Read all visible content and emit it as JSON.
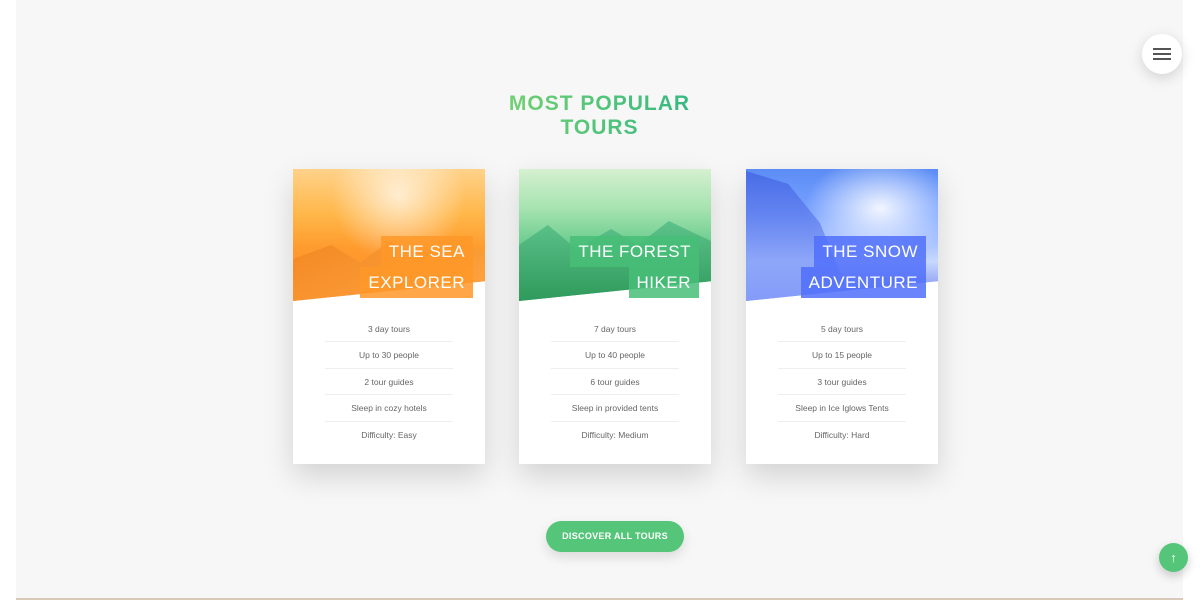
{
  "section": {
    "title": "MOST POPULAR TOURS"
  },
  "icons": {
    "menu": "hamburger-menu-icon",
    "scroll_top": "arrow-up-icon"
  },
  "colors": {
    "primary": "#55c57a",
    "orange": "#ff9b2e",
    "green": "#28b485",
    "blue": "#5b73f5"
  },
  "tours": [
    {
      "heading_line1": "THE SEA",
      "heading_line2": "EXPLORER",
      "details": [
        "3 day tours",
        "Up to 30 people",
        "2 tour guides",
        "Sleep in cozy hotels",
        "Difficulty: Easy"
      ]
    },
    {
      "heading_line1": "THE FOREST",
      "heading_line2": "HIKER",
      "details": [
        "7 day tours",
        "Up to 40 people",
        "6 tour guides",
        "Sleep in provided tents",
        "Difficulty: Medium"
      ]
    },
    {
      "heading_line1": "THE SNOW",
      "heading_line2": "ADVENTURE",
      "details": [
        "5 day tours",
        "Up to 15 people",
        "3 tour guides",
        "Sleep in Ice Iglows Tents",
        "Difficulty: Hard"
      ]
    }
  ],
  "cta": {
    "label": "DISCOVER ALL TOURS"
  },
  "scroll_top": {
    "glyph": "↑"
  }
}
